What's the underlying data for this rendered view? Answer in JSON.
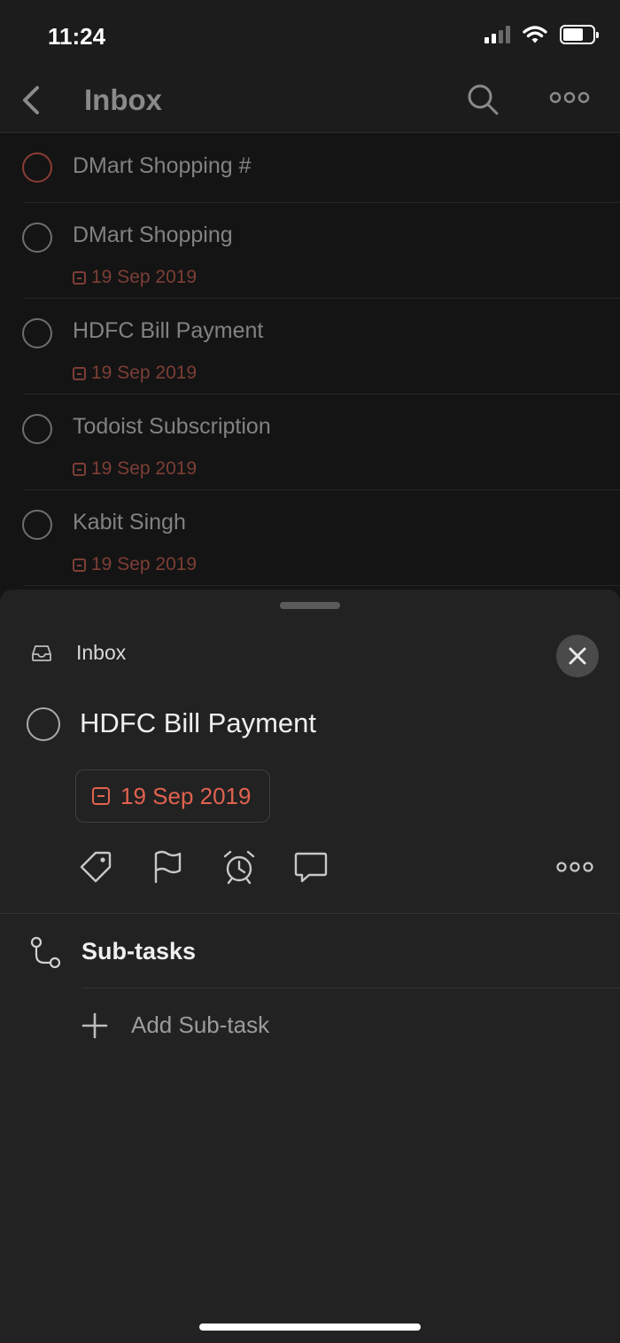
{
  "status_bar": {
    "time": "11:24"
  },
  "header": {
    "title": "Inbox"
  },
  "tasks": [
    {
      "title": "DMart Shopping #",
      "date": ""
    },
    {
      "title": "DMart Shopping",
      "date": "19 Sep 2019"
    },
    {
      "title": "HDFC Bill Payment",
      "date": "19 Sep 2019"
    },
    {
      "title": "Todoist Subscription",
      "date": "19 Sep 2019"
    },
    {
      "title": "Kabit Singh",
      "date": "19 Sep 2019"
    }
  ],
  "detail": {
    "project": "Inbox",
    "title": "HDFC Bill Payment",
    "due_date": "19 Sep 2019",
    "subtasks_heading": "Sub-tasks",
    "add_subtask_label": "Add Sub-task"
  },
  "colors": {
    "background": "#141414",
    "sheet": "#222222",
    "accent_red": "#e2624f",
    "priority_ring": "#8a3d35"
  },
  "icons": [
    "back-chevron-icon",
    "search-icon",
    "more-dots-icon",
    "inbox-tray-icon",
    "close-icon",
    "calendar-icon",
    "label-tag-icon",
    "flag-icon",
    "alarm-clock-icon",
    "comment-icon",
    "subtasks-icon",
    "plus-icon"
  ]
}
